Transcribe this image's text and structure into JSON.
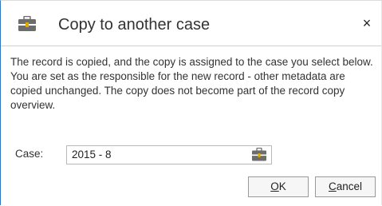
{
  "dialog": {
    "title": "Copy to another case",
    "close_glyph": "×",
    "title_icon": "briefcase-icon",
    "close_icon": "close-icon"
  },
  "message": {
    "paragraph_1": "The record is copied, and the copy is assigned to the case you select below.",
    "paragraph_2": "You are set as the responsible for the new record - other metadata are copied unchanged. The copy does not become part of the record copy overview."
  },
  "case_field": {
    "label": "Case:",
    "value": "2015 - 8",
    "lookup_icon": "briefcase-icon"
  },
  "buttons": {
    "ok_mnemonic": "O",
    "ok_rest": "K",
    "cancel_mnemonic": "C",
    "cancel_rest": "ancel"
  },
  "colors": {
    "accent_border": "#2b78c5",
    "icon_body": "#6d6d6d",
    "icon_stripe": "#e0a800"
  }
}
